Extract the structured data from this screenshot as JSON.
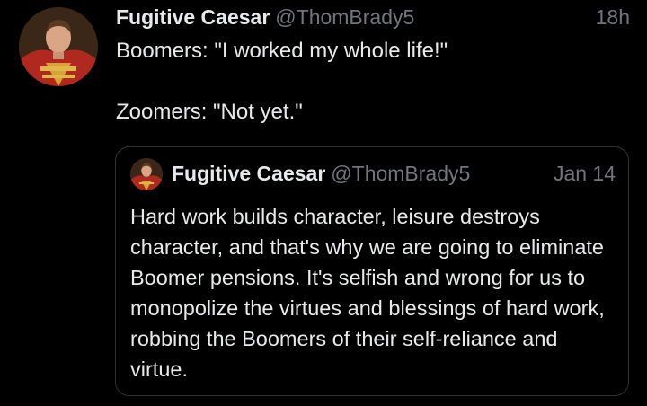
{
  "tweet": {
    "author": {
      "display_name": "Fugitive Caesar",
      "handle": "@ThomBrady5",
      "avatar_icon": "portrait-avatar"
    },
    "timestamp": "18h",
    "text": "Boomers: \"I worked my whole life!\"\n\nZoomers: \"Not yet.\""
  },
  "quoted_tweet": {
    "author": {
      "display_name": "Fugitive Caesar",
      "handle": "@ThomBrady5",
      "avatar_icon": "portrait-avatar"
    },
    "timestamp": "Jan 14",
    "text": "Hard work builds character, leisure destroys character, and that's why we are going to eliminate Boomer pensions. It's selfish and wrong for us to monopolize the virtues and blessings of hard work, robbing the Boomers of their self-reliance and virtue."
  },
  "colors": {
    "background": "#000000",
    "primary_text": "#e7e9ea",
    "secondary_text": "#71767b",
    "card_border": "#2f3336"
  }
}
